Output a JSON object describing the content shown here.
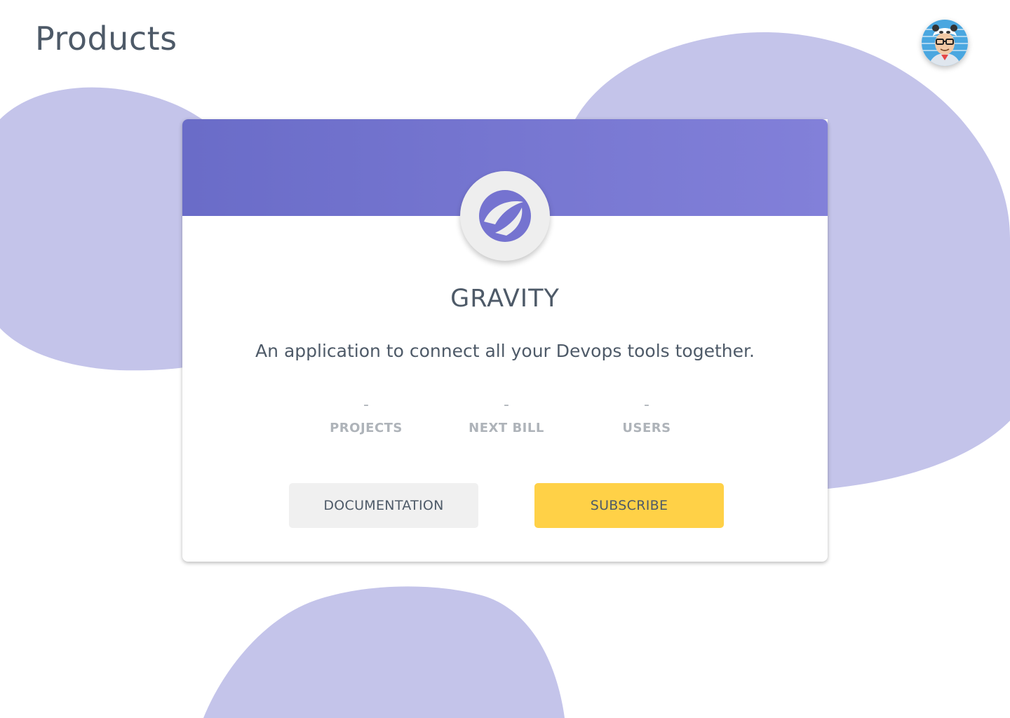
{
  "header": {
    "title": "Products",
    "avatar_icon": "user-avatar-icon"
  },
  "product": {
    "logo_icon": "gravity-logo-icon",
    "name": "GRAVITY",
    "description": "An application to connect all your Devops tools together.",
    "stats": [
      {
        "value": "-",
        "label": "PROJECTS"
      },
      {
        "value": "-",
        "label": "NEXT BILL"
      },
      {
        "value": "-",
        "label": "USERS"
      }
    ],
    "actions": {
      "documentation_label": "DOCUMENTATION",
      "subscribe_label": "SUBSCRIBE"
    }
  },
  "colors": {
    "header_gradient_start": "#6a6cc8",
    "header_gradient_end": "#8280d9",
    "blob": "#c4c4ea",
    "subscribe": "#ffd147",
    "documentation": "#f0f0f0",
    "text": "#4e5a68",
    "muted": "#aeb3b9"
  }
}
